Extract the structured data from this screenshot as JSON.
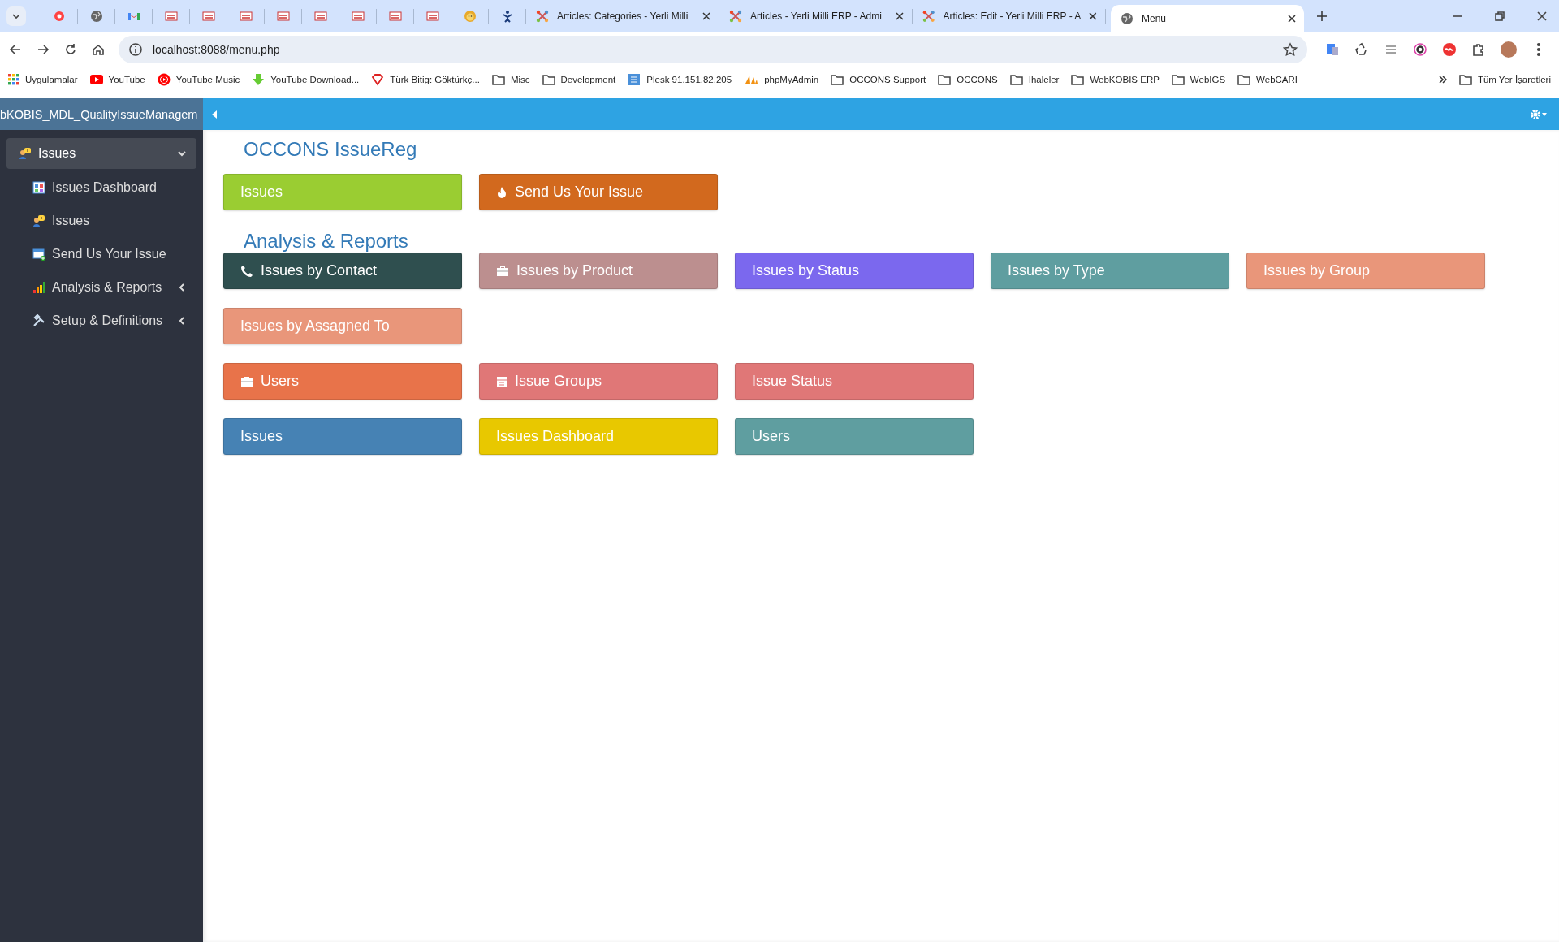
{
  "browser": {
    "pinned_tabs": [
      {
        "kind": "record",
        "selected": false
      },
      {
        "kind": "globe",
        "selected": false
      },
      {
        "kind": "mail",
        "selected": false
      },
      {
        "kind": "badge",
        "selected": false
      },
      {
        "kind": "badge",
        "selected": false
      },
      {
        "kind": "badge",
        "selected": false
      },
      {
        "kind": "badge",
        "selected": false
      },
      {
        "kind": "badge",
        "selected": false
      },
      {
        "kind": "badge",
        "selected": false
      },
      {
        "kind": "badge",
        "selected": false
      },
      {
        "kind": "badge",
        "selected": false
      },
      {
        "kind": "lion",
        "selected": false
      },
      {
        "kind": "figure",
        "selected": false
      }
    ],
    "tabs": [
      {
        "title": "Articles: Categories - Yerli Milli",
        "kind": "joomla",
        "selected": false
      },
      {
        "title": "Articles - Yerli Milli ERP - Admi",
        "kind": "joomla",
        "selected": false
      },
      {
        "title": "Articles: Edit - Yerli Milli ERP - A",
        "kind": "joomla",
        "selected": false
      },
      {
        "title": "Menu",
        "kind": "globe",
        "selected": true
      }
    ],
    "address": "localhost:8088/menu.php",
    "bookmarks": [
      {
        "label": "Uygulamalar",
        "kind": "apps"
      },
      {
        "label": "YouTube",
        "kind": "video"
      },
      {
        "label": "YouTube Music",
        "kind": "music"
      },
      {
        "label": "YouTube Download...",
        "kind": "download"
      },
      {
        "label": "Türk Bitig: Göktürkç...",
        "kind": "gem"
      },
      {
        "label": "Misc",
        "kind": "folder"
      },
      {
        "label": "Development",
        "kind": "folder"
      },
      {
        "label": "Plesk 91.151.82.205",
        "kind": "site"
      },
      {
        "label": "phpMyAdmin",
        "kind": "pma"
      },
      {
        "label": "OCCONS Support",
        "kind": "folder"
      },
      {
        "label": "OCCONS",
        "kind": "folder"
      },
      {
        "label": "Ihaleler",
        "kind": "folder"
      },
      {
        "label": "WebKOBIS ERP",
        "kind": "folder"
      },
      {
        "label": "WebIGS",
        "kind": "folder"
      },
      {
        "label": "WebCARI",
        "kind": "folder"
      }
    ],
    "other_bookmarks": "Tüm Yer İşaretleri"
  },
  "app": {
    "brand": "bKOBIS_MDL_QualityIssueManagem",
    "sidebar": {
      "items": [
        {
          "label": "Issues",
          "kind": "issues",
          "selected": true,
          "expanded": true,
          "children": [
            {
              "label": "Issues Dashboard",
              "kind": "dashboard",
              "selected": false
            },
            {
              "label": "Issues",
              "kind": "issues",
              "selected": false
            },
            {
              "label": "Send Us Your Issue",
              "kind": "send",
              "selected": false
            },
            {
              "label": "Analysis & Reports",
              "kind": "chart",
              "selected": false,
              "expanded": false
            },
            {
              "label": "Setup & Definitions",
              "kind": "tools",
              "selected": false,
              "expanded": false
            }
          ]
        }
      ]
    },
    "sections": [
      {
        "title": "OCCONS IssueReg",
        "rows": [
          [
            {
              "label": "Issues",
              "color": "#9acd32",
              "kind": "plain"
            },
            {
              "label": "Send Us Your Issue",
              "color": "#d2691e",
              "kind": "fire"
            }
          ]
        ]
      },
      {
        "title": "Analysis & Reports",
        "rows": [
          [
            {
              "label": "Issues by Contact",
              "color": "#2f4f4f",
              "kind": "phone"
            },
            {
              "label": "Issues by Product",
              "color": "#bc8f8f",
              "kind": "briefcase"
            },
            {
              "label": "Issues by Status",
              "color": "#7b68ee",
              "kind": "plain"
            },
            {
              "label": "Issues by Type",
              "color": "#5f9ea0",
              "kind": "plain"
            },
            {
              "label": "Issues by Group",
              "color": "#e9967a",
              "kind": "plain"
            }
          ],
          [
            {
              "label": "Issues by Assagned To",
              "color": "#e9967a",
              "kind": "plain"
            }
          ]
        ]
      },
      {
        "rows": [
          [
            {
              "label": "Users",
              "color": "#e8734a",
              "kind": "briefcase"
            },
            {
              "label": "Issue Groups",
              "color": "#e07777",
              "kind": "calendar"
            },
            {
              "label": "Issue Status",
              "color": "#e07777",
              "kind": "plain"
            }
          ],
          [
            {
              "label": "Issues",
              "color": "#4682b4",
              "kind": "plain"
            },
            {
              "label": "Issues Dashboard",
              "color": "#e8c800",
              "kind": "plain"
            },
            {
              "label": "Users",
              "color": "#5f9ea0",
              "kind": "plain"
            }
          ]
        ]
      }
    ]
  }
}
